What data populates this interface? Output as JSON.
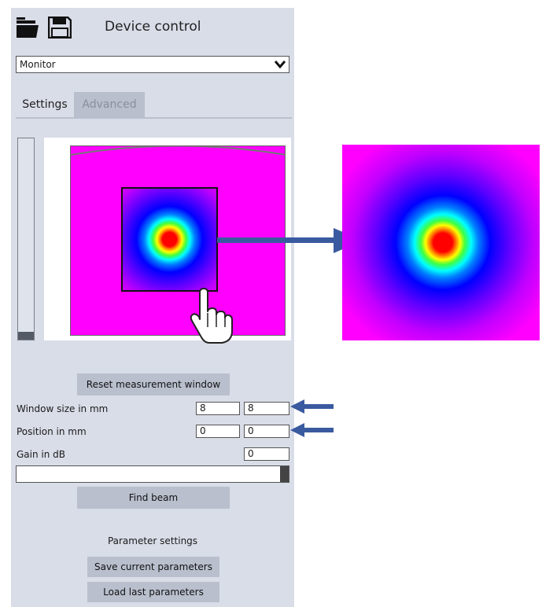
{
  "header": {
    "title": "Device control",
    "open_icon": "folder-open-icon",
    "save_icon": "floppy-disk-icon"
  },
  "mode_select": {
    "value": "Monitor"
  },
  "tabs": [
    {
      "label": "Settings",
      "active": true
    },
    {
      "label": "Advanced",
      "active": false
    }
  ],
  "controls": {
    "reset_label": "Reset measurement window",
    "window_size": {
      "label": "Window size in mm",
      "x": "8",
      "y": "8"
    },
    "position": {
      "label": "Position in mm",
      "x": "0",
      "y": "0"
    },
    "gain": {
      "label": "Gain in dB",
      "value": "0"
    },
    "find_beam_label": "Find beam"
  },
  "parameters": {
    "title": "Parameter settings",
    "save_label": "Save current parameters",
    "load_label": "Load last parameters"
  },
  "colors": {
    "panel": "#d9dde8",
    "button": "#b9bfcd",
    "arrow": "#3a5aa0",
    "sensor_background": "#ff00ff"
  }
}
